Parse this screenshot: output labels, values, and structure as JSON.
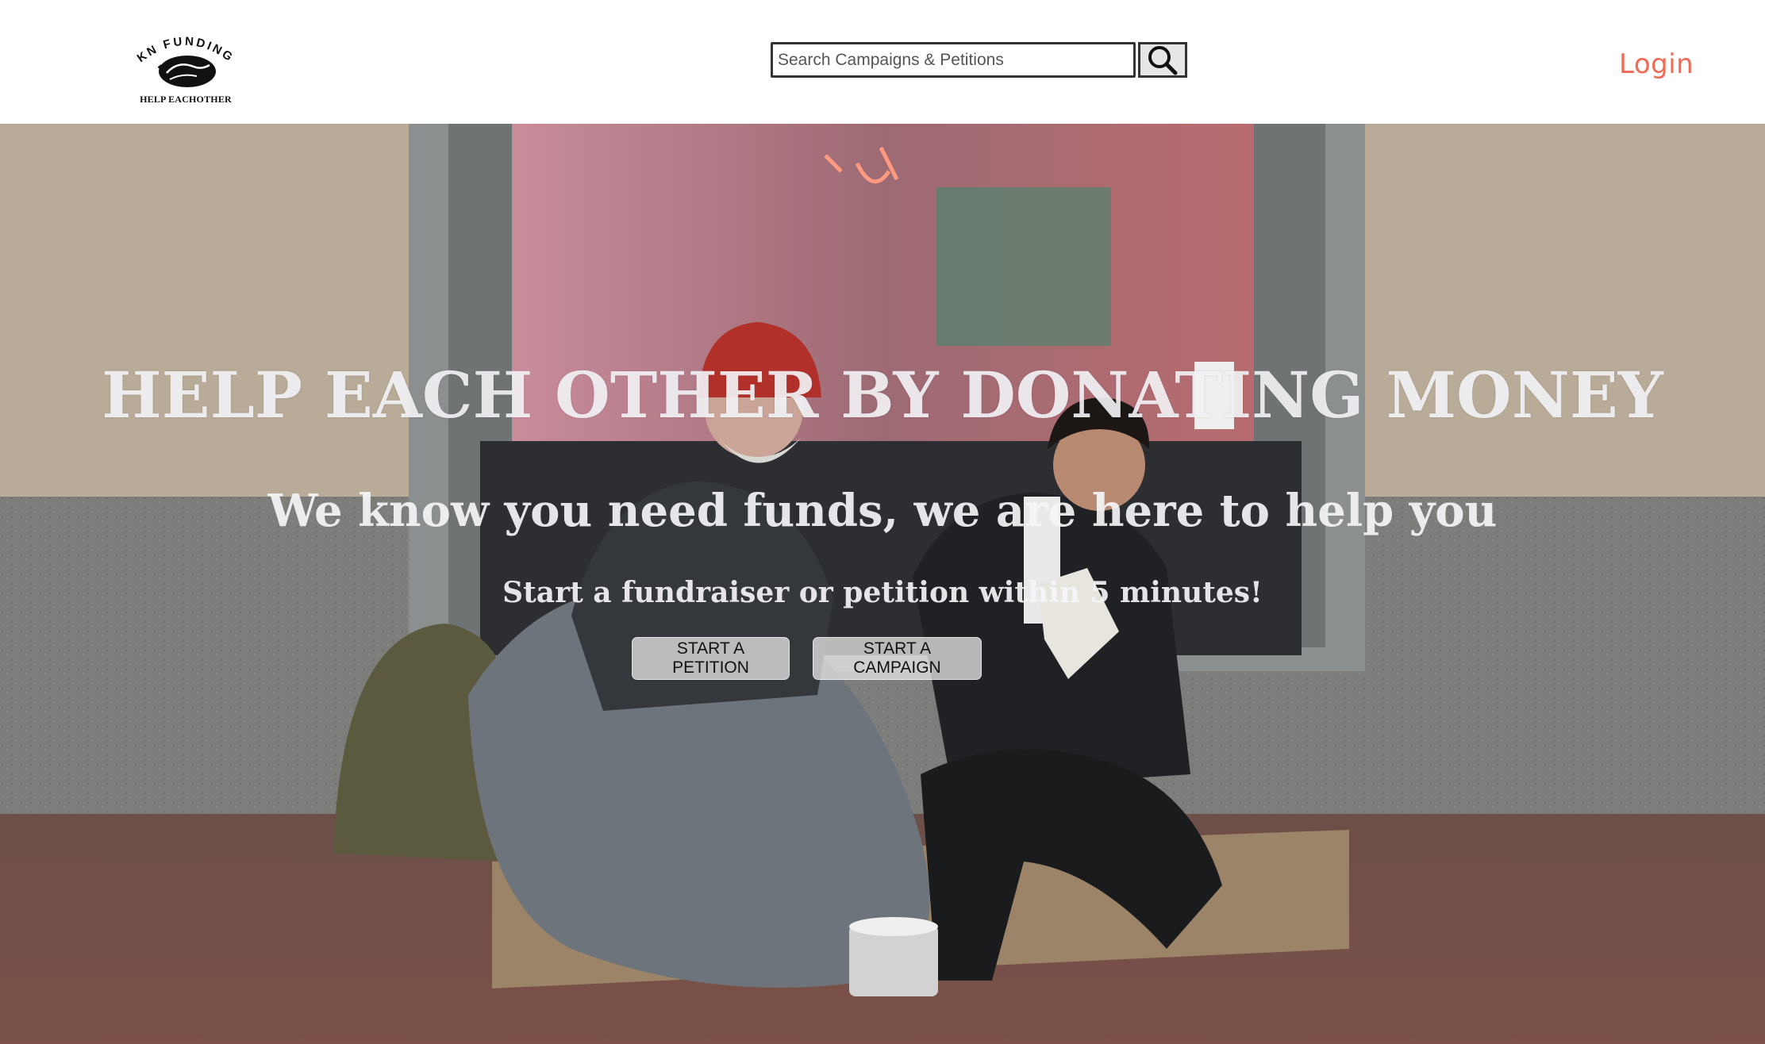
{
  "header": {
    "logo": {
      "name": "KN FUNDING",
      "tagline": "HELP EACHOTHER"
    },
    "search": {
      "placeholder": "Search Campaigns & Petitions",
      "value": "",
      "button_icon": "search-icon"
    },
    "login_label": "Login"
  },
  "hero": {
    "headline": "HELP EACH OTHER BY DONATING MONEY",
    "subheadline": "We know you need funds, we are here to help you",
    "tagline": "Start a fundraiser or petition within 5 minutes!",
    "buttons": {
      "petition": "START A PETITION",
      "campaign": "START A CAMPAIGN"
    }
  },
  "colors": {
    "login": "#f06a55",
    "hero_text": "#f5f5f8",
    "button_bg": "#e1e1e1"
  }
}
